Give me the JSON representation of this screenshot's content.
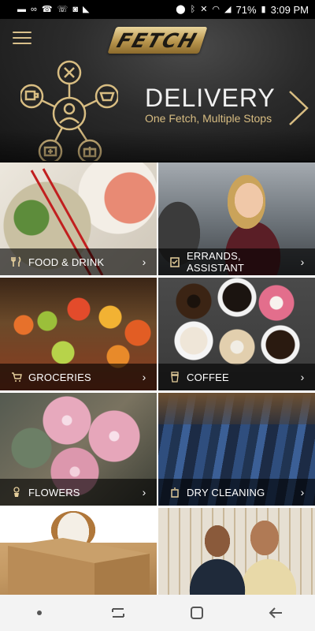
{
  "status_bar": {
    "battery": "71%",
    "time": "3:09 PM",
    "left_icons": [
      "message-icon",
      "voicemail-icon",
      "missed-call-icon",
      "wifi-call-icon",
      "instagram-icon",
      "flipboard-icon"
    ],
    "right_icons": [
      "location-icon",
      "bluetooth-icon",
      "mute-icon",
      "wifi-icon",
      "signal-icon",
      "battery-icon"
    ]
  },
  "header": {
    "logo": "FETCH",
    "banner_title": "DELIVERY",
    "banner_subtitle": "One Fetch, Multiple Stops"
  },
  "tiles": [
    {
      "label": "FOOD & DRINK",
      "icon": "fork-knife-icon"
    },
    {
      "label": "ERRANDS, ASSISTANT",
      "icon": "clipboard-check-icon"
    },
    {
      "label": "GROCERIES",
      "icon": "cart-icon"
    },
    {
      "label": "COFFEE",
      "icon": "coffee-cup-icon"
    },
    {
      "label": "FLOWERS",
      "icon": "flower-pot-icon"
    },
    {
      "label": "DRY CLEANING",
      "icon": "garment-bag-icon"
    }
  ],
  "colors": {
    "gold": "#d8bd82",
    "header_dark": "#1e1e1e",
    "nav_bar": "#f3f3f3"
  }
}
